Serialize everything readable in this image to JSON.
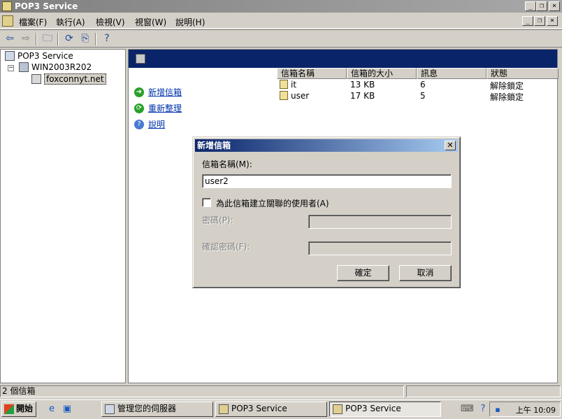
{
  "window": {
    "title": "POP3 Service"
  },
  "menubar": {
    "items": [
      "檔案(F)",
      "執行(A)",
      "檢視(V)",
      "視窗(W)",
      "說明(H)"
    ]
  },
  "window_controls": {
    "minimize": "_",
    "restore": "❐",
    "close": "×"
  },
  "tree": {
    "root": "POP3 Service",
    "server": "WIN2003R202",
    "domain": "foxconnyt.net"
  },
  "tasks": [
    {
      "label": "新增信箱",
      "icon": "add-icon"
    },
    {
      "label": "重新整理",
      "icon": "refresh-icon"
    },
    {
      "label": "說明",
      "icon": "help-icon"
    }
  ],
  "list": {
    "columns": [
      "信箱名稱",
      "信箱的大小",
      "訊息",
      "狀態"
    ],
    "rows": [
      {
        "name": "it",
        "size": "13 KB",
        "messages": "6",
        "status": "解除鎖定"
      },
      {
        "name": "user",
        "size": "17 KB",
        "messages": "5",
        "status": "解除鎖定"
      }
    ]
  },
  "dialog": {
    "title": "新增信箱",
    "mailbox_label": "信箱名稱(M):",
    "mailbox_value": "user2",
    "create_user_label": "為此信箱建立關聯的使用者(A)",
    "create_user_checked": false,
    "password_label": "密碼(P):",
    "confirm_label": "確認密碼(F):",
    "ok": "確定",
    "cancel": "取消"
  },
  "statusbar": {
    "text": "2 個信箱"
  },
  "taskbar": {
    "start": "開始",
    "buttons": [
      "管理您的伺服器",
      "POP3 Service",
      "POP3 Service"
    ],
    "clock": "上午 10:09"
  },
  "colors": {
    "content_header": "#0a246a",
    "dialog_title": "#0a246a",
    "link": "#0033aa"
  }
}
